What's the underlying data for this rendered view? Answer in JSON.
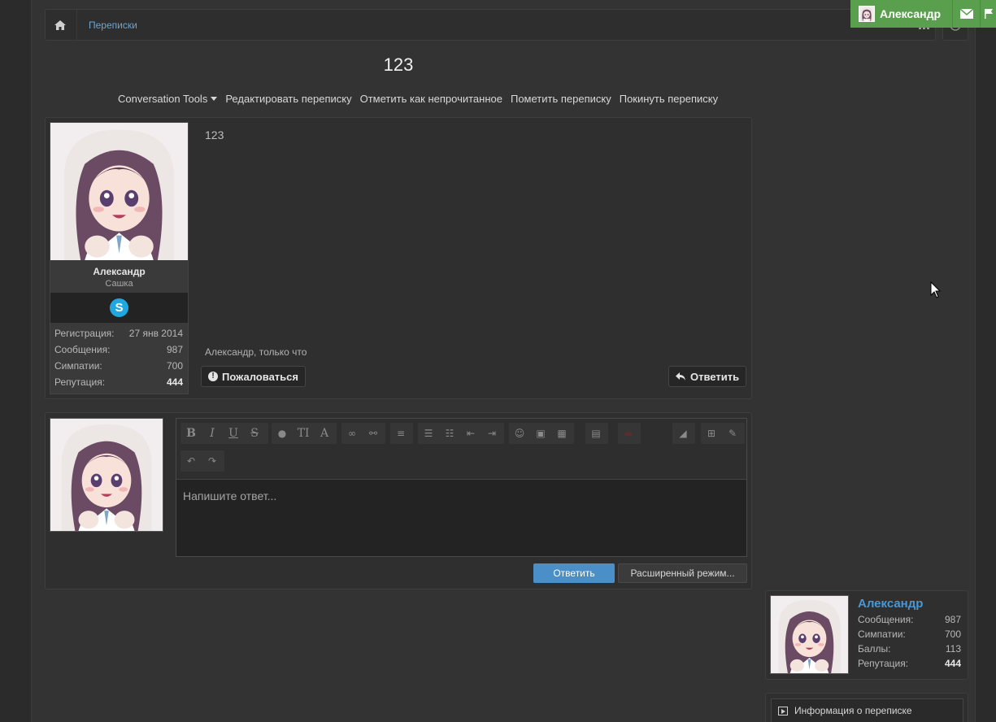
{
  "breadcrumb": {
    "link": "Переписки"
  },
  "conversation": {
    "title": "123",
    "tools": {
      "dropdown": "Conversation Tools",
      "edit": "Редактировать переписку",
      "mark_unread": "Отметить как непрочитанное",
      "star": "Пометить переписку",
      "leave": "Покинуть переписку"
    }
  },
  "message": {
    "text": "123",
    "meta": "Александр, только что",
    "report_label": "Пожаловаться",
    "reply_label": "Ответить",
    "author": {
      "name": "Александр",
      "title": "Сашка",
      "stats": [
        {
          "label": "Регистрация:",
          "value": "27 янв 2014"
        },
        {
          "label": "Сообщения:",
          "value": "987"
        },
        {
          "label": "Симпатии:",
          "value": "700"
        },
        {
          "label": "Репутация:",
          "value": "444"
        }
      ]
    }
  },
  "reply": {
    "placeholder": "Напишите ответ...",
    "submit_label": "Ответить",
    "advanced_label": "Расширенный режим..."
  },
  "sidebar": {
    "user": {
      "name": "Александр",
      "stats": [
        {
          "label": "Сообщения:",
          "value": "987"
        },
        {
          "label": "Симпатии:",
          "value": "700"
        },
        {
          "label": "Баллы:",
          "value": "113"
        },
        {
          "label": "Репутация:",
          "value": "444"
        }
      ]
    },
    "info_label": "Информация о переписке"
  },
  "topbar": {
    "username": "Александр"
  },
  "colors": {
    "accent_green": "#5a9f4e",
    "link_blue": "#4a97d3",
    "button_blue": "#4a8fc7"
  }
}
